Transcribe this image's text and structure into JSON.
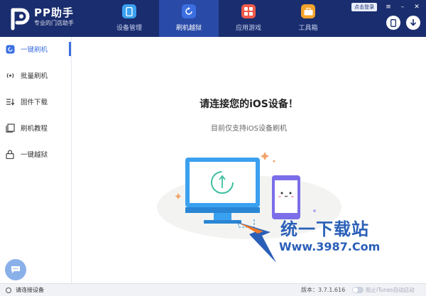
{
  "header": {
    "brand_name": "PP助手",
    "brand_sub": "专业的门店助手",
    "login_label": "点击登录",
    "tabs": [
      {
        "label": "设备管理",
        "icon": "phone-icon",
        "color": "#3aa0f0"
      },
      {
        "label": "刷机越狱",
        "icon": "refresh-icon",
        "color": "#3b6fe0"
      },
      {
        "label": "应用游戏",
        "icon": "apps-icon",
        "color": "#f05a4a"
      },
      {
        "label": "工具箱",
        "icon": "toolbox-icon",
        "color": "#f2a32c"
      }
    ],
    "active_tab": 1,
    "window_controls": [
      "≡",
      "–",
      "✕"
    ]
  },
  "sidebar": {
    "items": [
      {
        "label": "一键刷机",
        "icon": "flash-icon",
        "active": true
      },
      {
        "label": "批量刷机",
        "icon": "broadcast-icon",
        "active": false
      },
      {
        "label": "固件下载",
        "icon": "download-list-icon",
        "active": false
      },
      {
        "label": "刷机教程",
        "icon": "tutorial-icon",
        "active": false
      },
      {
        "label": "一键越狱",
        "icon": "lock-icon",
        "active": false
      }
    ]
  },
  "main": {
    "title": "请连接您的iOS设备！",
    "subtitle": "目前仅支持iOS设备刷机"
  },
  "watermark": {
    "text": "统一下载站",
    "url": "Www.3987.Com"
  },
  "statusbar": {
    "status": "请连接设备",
    "version": "版本：3.7.1.616",
    "itunes_label": "阻止iTunes自动启动"
  },
  "colors": {
    "header_bg": "#1a2d6e",
    "accent": "#3b6fe0"
  }
}
